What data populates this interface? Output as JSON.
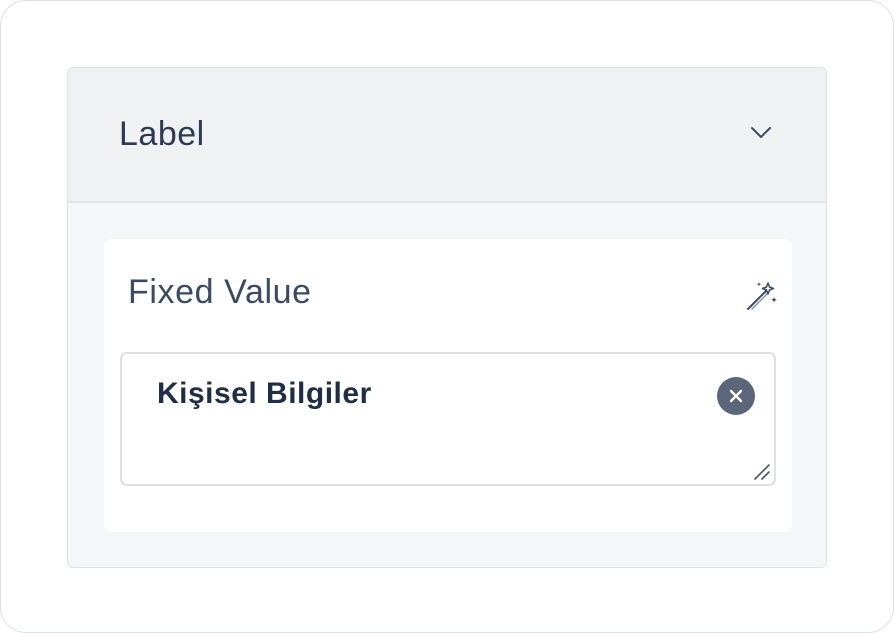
{
  "panel": {
    "title": "Label",
    "collapse_icon": "chevron-down-icon"
  },
  "field": {
    "label": "Fixed Value",
    "action_icon": "magic-wand-icon",
    "value": "Kişisel Bilgiler",
    "clear_icon": "clear-circle-icon"
  },
  "colors": {
    "title_text": "#2c3a52",
    "value_text": "#1f2d45",
    "clear_button": "#5b667a",
    "panel_bg": "#f5f6f8",
    "header_bg": "#f0f1f3"
  }
}
